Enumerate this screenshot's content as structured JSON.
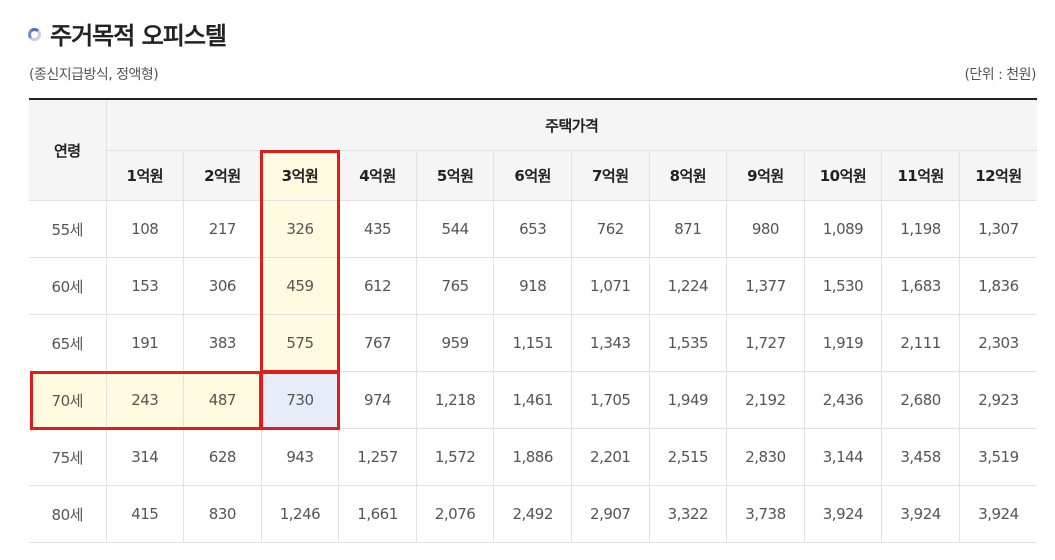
{
  "header": {
    "title": "주거목적 오피스텔",
    "subtitle": "(종신지급방식, 정액형)",
    "unit": "(단위 : 천원)"
  },
  "table": {
    "age_header": "연령",
    "group_header": "주택가격",
    "price_columns": [
      "1억원",
      "2억원",
      "3억원",
      "4억원",
      "5억원",
      "6억원",
      "7억원",
      "8억원",
      "9억원",
      "10억원",
      "11억원",
      "12억원"
    ],
    "rows": [
      {
        "age": "55세",
        "values": [
          "108",
          "217",
          "326",
          "435",
          "544",
          "653",
          "762",
          "871",
          "980",
          "1,089",
          "1,198",
          "1,307"
        ]
      },
      {
        "age": "60세",
        "values": [
          "153",
          "306",
          "459",
          "612",
          "765",
          "918",
          "1,071",
          "1,224",
          "1,377",
          "1,530",
          "1,683",
          "1,836"
        ]
      },
      {
        "age": "65세",
        "values": [
          "191",
          "383",
          "575",
          "767",
          "959",
          "1,151",
          "1,343",
          "1,535",
          "1,727",
          "1,919",
          "2,111",
          "2,303"
        ]
      },
      {
        "age": "70세",
        "values": [
          "243",
          "487",
          "730",
          "974",
          "1,218",
          "1,461",
          "1,705",
          "1,949",
          "2,192",
          "2,436",
          "2,680",
          "2,923"
        ]
      },
      {
        "age": "75세",
        "values": [
          "314",
          "628",
          "943",
          "1,257",
          "1,572",
          "1,886",
          "2,201",
          "2,515",
          "2,830",
          "3,144",
          "3,458",
          "3,519"
        ]
      },
      {
        "age": "80세",
        "values": [
          "415",
          "830",
          "1,246",
          "1,661",
          "2,076",
          "2,492",
          "2,907",
          "3,322",
          "3,738",
          "3,924",
          "3,924",
          "3,924"
        ]
      }
    ],
    "highlight_column": "3억원",
    "highlight_row": "70세",
    "colors": {
      "highlight": "#fffbe0",
      "intersection": "#e7ecf8",
      "outline": "#e01d1d"
    }
  }
}
